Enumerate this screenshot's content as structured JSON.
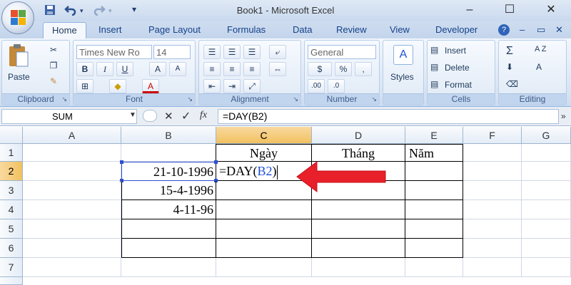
{
  "window": {
    "title": "Book1 - Microsoft Excel",
    "minimize": "–",
    "maximize": "☐",
    "close": "✕"
  },
  "quick_access": {
    "save_icon": "save-icon",
    "undo_icon": "undo-icon",
    "redo_icon": "redo-icon",
    "customize": "▾"
  },
  "tabs": [
    "Home",
    "Insert",
    "Page Layout",
    "Formulas",
    "Data",
    "Review",
    "View",
    "Developer"
  ],
  "tab_right": {
    "help": "?",
    "minimize": "–",
    "restore": "▭",
    "close": "✕"
  },
  "ribbon": {
    "clipboard": {
      "label": "Clipboard",
      "paste": "Paste"
    },
    "font": {
      "label": "Font",
      "font_name": "Times New Ro",
      "font_size": "14",
      "bold": "B",
      "italic": "I",
      "underline": "U",
      "grow": "A",
      "shrink": "A",
      "font_color": "A"
    },
    "alignment": {
      "label": "Alignment"
    },
    "number": {
      "label": "Number",
      "format": "General",
      "currency": "$",
      "percent": "%",
      "comma": ",",
      "inc_dec": ".00",
      "dec_dec": ".0"
    },
    "styles": {
      "label": "Styles"
    },
    "cells": {
      "label": "Cells",
      "insert": "Insert",
      "delete": "Delete",
      "format": "Format"
    },
    "editing": {
      "label": "Editing",
      "sum": "Σ",
      "sort": "A Z",
      "find": "A"
    }
  },
  "formula_bar": {
    "name_box": "SUM",
    "cancel": "✕",
    "enter": "✓",
    "fx": "fx",
    "formula": "=DAY(B2)"
  },
  "columns": [
    "A",
    "B",
    "C",
    "D",
    "E",
    "F",
    "G"
  ],
  "rows": [
    "1",
    "2",
    "3",
    "4",
    "5",
    "6",
    "7"
  ],
  "cells": {
    "C1": "Ngày",
    "D1": "Tháng",
    "E1": "Năm",
    "B2": "21-10-1996",
    "B3": "15-4-1996",
    "B4": "4-11-96",
    "C2_prefix": "=DAY(",
    "C2_ref": "B2",
    "C2_suffix": ")"
  },
  "colors": {
    "ref_highlight": "#1f4ed8",
    "arrow": "#e8202a",
    "selection_header": "#f1c15f"
  }
}
